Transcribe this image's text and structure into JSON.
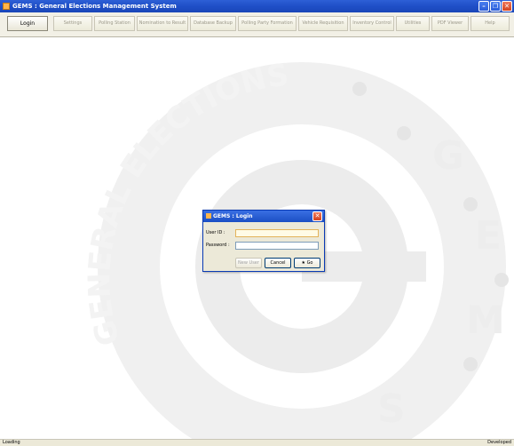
{
  "window": {
    "title": "GEMS : General Elections Management System"
  },
  "toolbar": {
    "items": [
      {
        "label": "Login",
        "active": true
      },
      {
        "label": "Settings"
      },
      {
        "label": "Polling Station"
      },
      {
        "label": "Nomination to Result"
      },
      {
        "label": "Database Backup"
      },
      {
        "label": "Polling Party Formation"
      },
      {
        "label": "Vehicle Requisition"
      },
      {
        "label": "Inventory Control"
      },
      {
        "label": "Utilities"
      },
      {
        "label": "PDF Viewer"
      },
      {
        "label": "Help"
      }
    ]
  },
  "watermark": {
    "text_top": "GENERAL ELECTIONS MANAGEMENT SYSTEM",
    "letters": [
      "G",
      "E",
      "M",
      "S"
    ]
  },
  "dialog": {
    "title": "GEMS : Login",
    "user_id_label": "User ID :",
    "password_label": "Password :",
    "user_id_value": "",
    "password_value": "",
    "new_user_label": "New User",
    "cancel_label": "Cancel",
    "go_label": "Go"
  },
  "statusbar": {
    "left": "Loading",
    "right": "Developed"
  }
}
